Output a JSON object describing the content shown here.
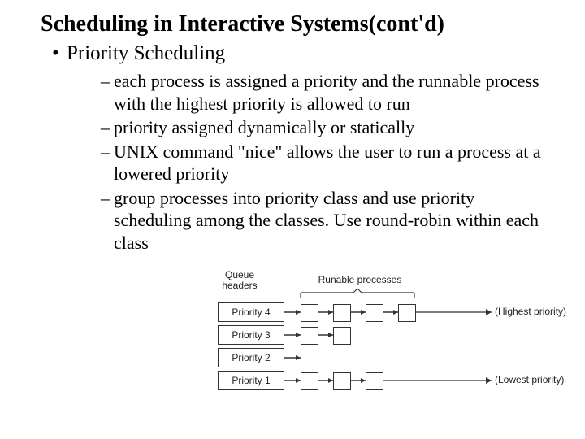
{
  "title": "Scheduling in Interactive Systems(cont'd)",
  "bullet": "Priority Scheduling",
  "dashes": [
    "each process is assigned a priority and the runnable process with the highest priority is allowed to run",
    "priority assigned dynamically or statically",
    "UNIX command \"nice\" allows the user to run a process at a lowered priority",
    "group processes into priority class and use priority scheduling among the classes. Use round-robin within each class"
  ],
  "diagram": {
    "queue_headers_label": "Queue\nheaders",
    "runable_label": "Runable processes",
    "priorities": [
      "Priority 4",
      "Priority 3",
      "Priority 2",
      "Priority 1"
    ],
    "row_counts": [
      4,
      2,
      1,
      3
    ],
    "highest": "(Highest priority)",
    "lowest": "(Lowest priority)"
  }
}
